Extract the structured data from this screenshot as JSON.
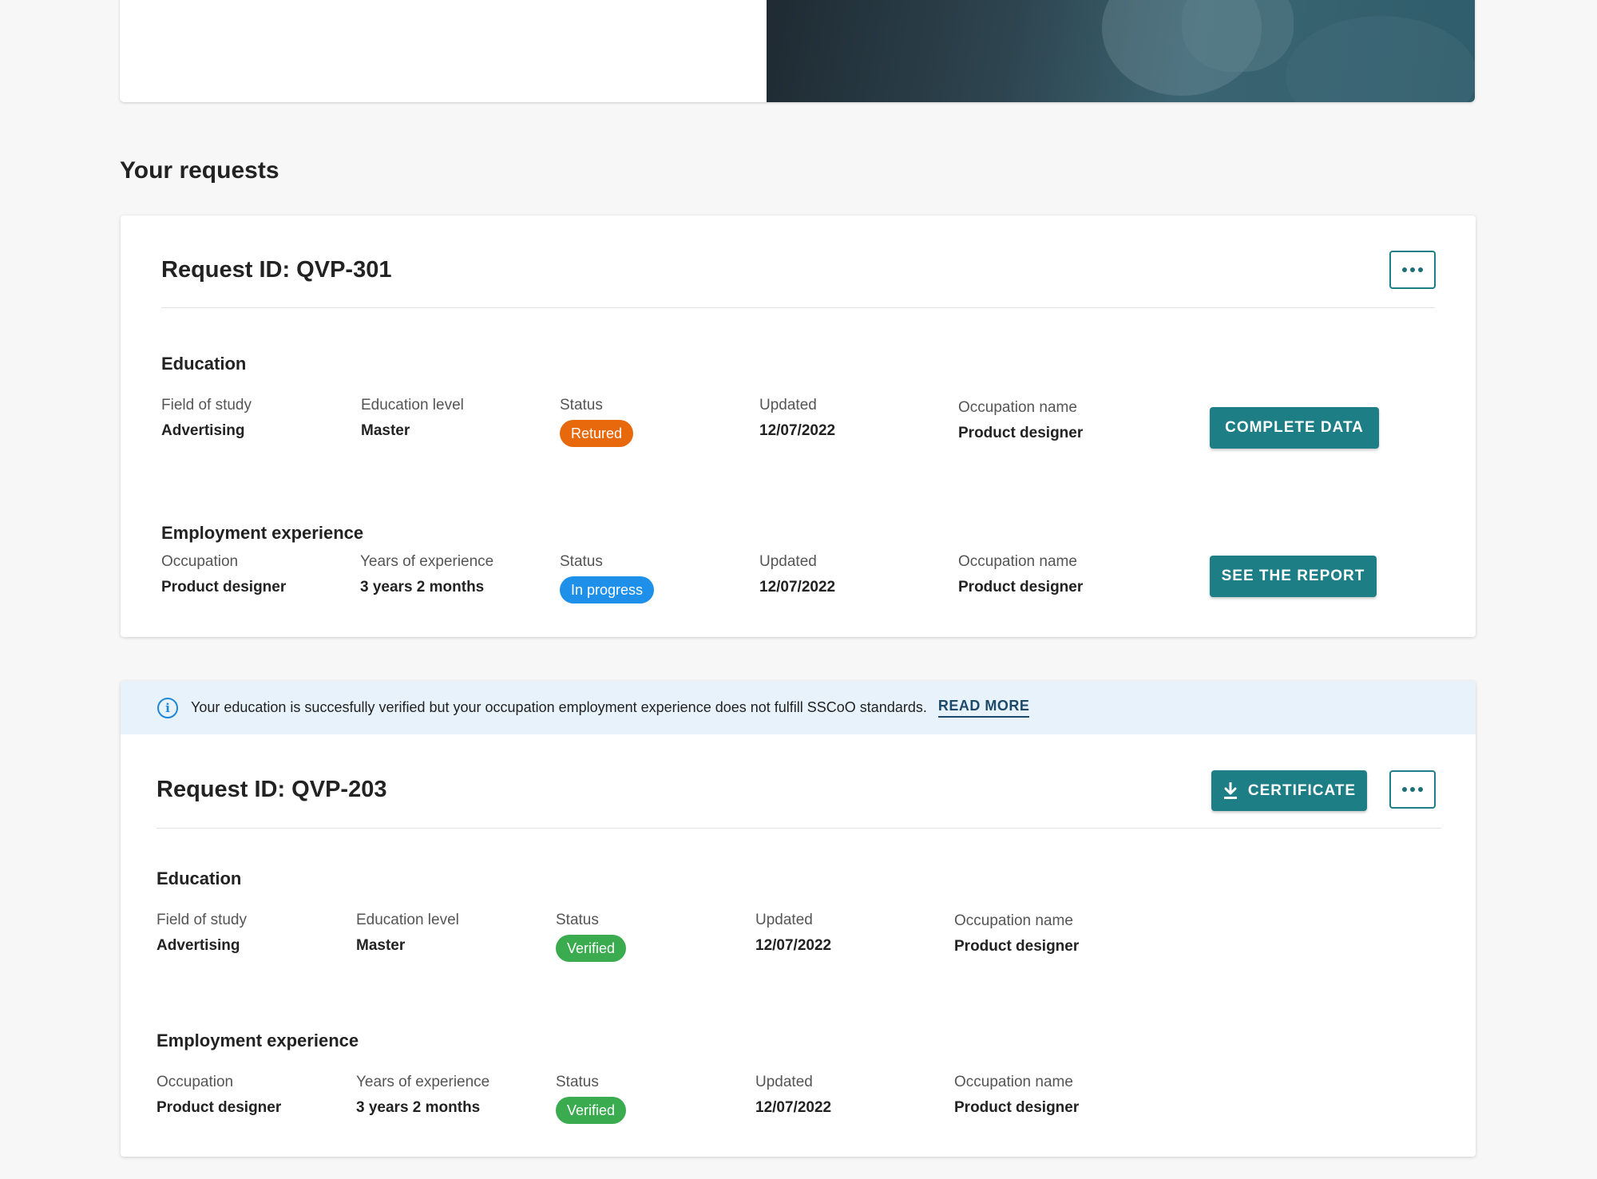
{
  "section_title": "Your requests",
  "requests": [
    {
      "title": "Request ID: QVP-301",
      "education": {
        "heading": "Education",
        "fields": [
          {
            "label": "Field of study",
            "value": "Advertising"
          },
          {
            "label": "Education level",
            "value": "Master"
          },
          {
            "label": "Status",
            "status": "Retured"
          },
          {
            "label": "Updated",
            "value": "12/07/2022"
          },
          {
            "label": "Occupation name",
            "value": "Product designer"
          }
        ],
        "action": "COMPLETE DATA"
      },
      "employment": {
        "heading": "Employment experience",
        "fields": [
          {
            "label": "Occupation",
            "value": "Product designer"
          },
          {
            "label": "Years of experience",
            "value": "3 years 2 months"
          },
          {
            "label": "Status",
            "status": "In progress"
          },
          {
            "label": "Updated",
            "value": "12/07/2022"
          },
          {
            "label": "Occupation name",
            "value": "Product designer"
          }
        ],
        "action": "SEE THE REPORT"
      }
    },
    {
      "banner": {
        "text": "Your education is succesfully verified but your occupation employment experience does not fulfill SSCoO standards.",
        "link": "READ MORE"
      },
      "title": "Request ID: QVP-203",
      "certificate_label": "CERTIFICATE",
      "education": {
        "heading": "Education",
        "fields": [
          {
            "label": "Field of study",
            "value": "Advertising"
          },
          {
            "label": "Education level",
            "value": "Master"
          },
          {
            "label": "Status",
            "status": "Verified"
          },
          {
            "label": "Updated",
            "value": "12/07/2022"
          },
          {
            "label": "Occupation name",
            "value": "Product designer"
          }
        ]
      },
      "employment": {
        "heading": "Employment experience",
        "fields": [
          {
            "label": "Occupation",
            "value": "Product designer"
          },
          {
            "label": "Years of experience",
            "value": "3 years 2 months"
          },
          {
            "label": "Status",
            "status": "Verified"
          },
          {
            "label": "Updated",
            "value": "12/07/2022"
          },
          {
            "label": "Occupation name",
            "value": "Product designer"
          }
        ]
      }
    }
  ],
  "colors": {
    "primary": "#1e7e86",
    "returned": "#e8680c",
    "in_progress": "#1e90ea",
    "verified": "#3bab4f",
    "banner_bg": "#e7f2fb"
  },
  "icons": {
    "more": "more-horizontal-icon",
    "download": "download-icon",
    "info": "info-icon"
  }
}
